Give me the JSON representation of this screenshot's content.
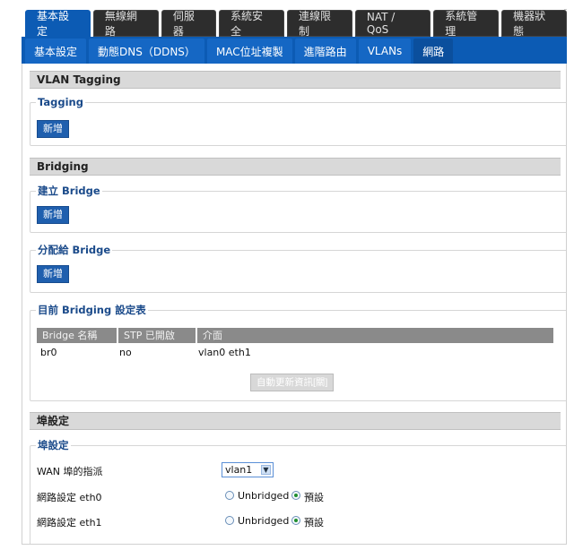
{
  "top_tabs": [
    "基本設定",
    "無線網路",
    "伺服器",
    "系統安全",
    "連線限制",
    "NAT / QoS",
    "系統管理",
    "機器狀態"
  ],
  "sub_tabs": [
    "基本設定",
    "動態DNS（DDNS）",
    "MAC位址複製",
    "進階路由",
    "VLANs",
    "網路"
  ],
  "vlan_tagging": {
    "header": "VLAN Tagging",
    "tagging_legend": "Tagging",
    "add_label": "新增"
  },
  "bridging": {
    "header": "Bridging",
    "create_legend": "建立 Bridge",
    "create_add_label": "新增",
    "assign_legend": "分配給 Bridge",
    "assign_add_label": "新增",
    "table_legend": "目前 Bridging 設定表",
    "columns": [
      "Bridge 名稱",
      "STP 已開啟",
      "介面"
    ],
    "row": {
      "name": "br0",
      "stp": "no",
      "interfaces": "vlan0 eth1"
    },
    "refresh_label": "自動更新資訊[關]"
  },
  "port_setup": {
    "header": "埠設定",
    "legend": "埠設定",
    "wan_label": "WAN 埠的指派",
    "wan_value": "vlan1",
    "eth0_label": "網路設定 eth0",
    "eth1_label": "網路設定 eth1",
    "opt_unbridged": "Unbridged",
    "opt_default": "預設"
  }
}
